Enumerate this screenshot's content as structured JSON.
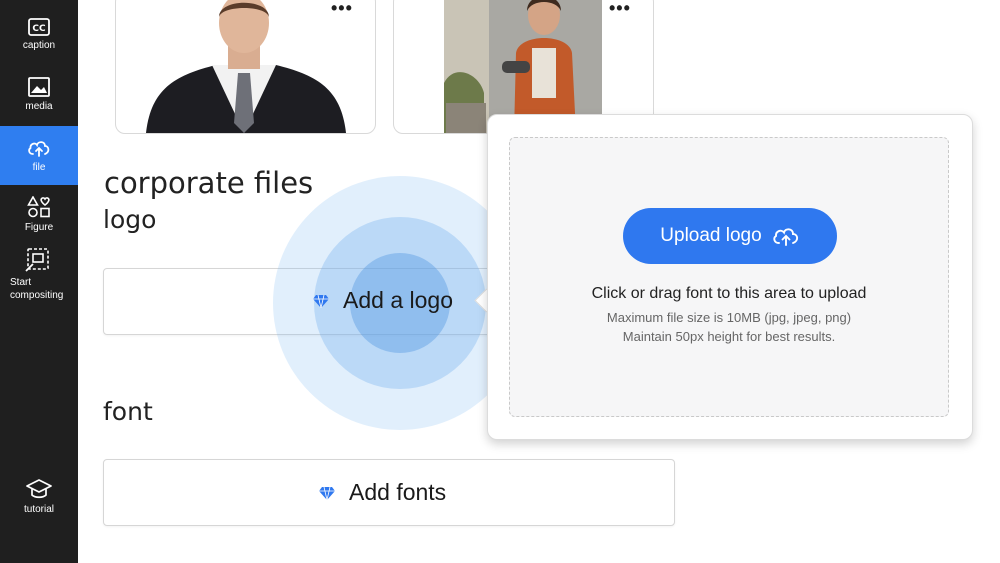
{
  "sidebar": {
    "items": [
      {
        "label": "caption",
        "icon": "cc-icon"
      },
      {
        "label": "media",
        "icon": "image-icon"
      },
      {
        "label": "file",
        "icon": "cloud-upload-icon"
      },
      {
        "label": "Figure",
        "icon": "shapes-icon"
      },
      {
        "label": "Start compositing",
        "icon": "compose-icon"
      },
      {
        "label": "tutorial",
        "icon": "graduation-cap-icon"
      }
    ],
    "active": "file"
  },
  "thumbnails": [
    {
      "alt": "man in suit",
      "menu": "•••"
    },
    {
      "alt": "woman in kitchen",
      "menu": "•••"
    }
  ],
  "sections": {
    "corporate_files": "corporate files",
    "logo": "logo",
    "font": "font"
  },
  "logo_field": {
    "button_label": "Add a logo",
    "icon": "diamond-icon"
  },
  "font_field": {
    "button_label": "Add fonts",
    "icon": "diamond-icon"
  },
  "upload_popup": {
    "button_label": "Upload logo",
    "button_icon": "cloud-upload-icon",
    "instruction": "Click or drag font to this area to upload",
    "max_size": "Maximum file size is 10MB (jpg, jpeg, png)",
    "height_hint": "Maintain 50px height for best results."
  },
  "colors": {
    "sidebar_bg": "#1f1f1f",
    "active_item": "#2f7ef0",
    "primary_button": "#2f78ef",
    "diamond": "#2f78ef"
  }
}
